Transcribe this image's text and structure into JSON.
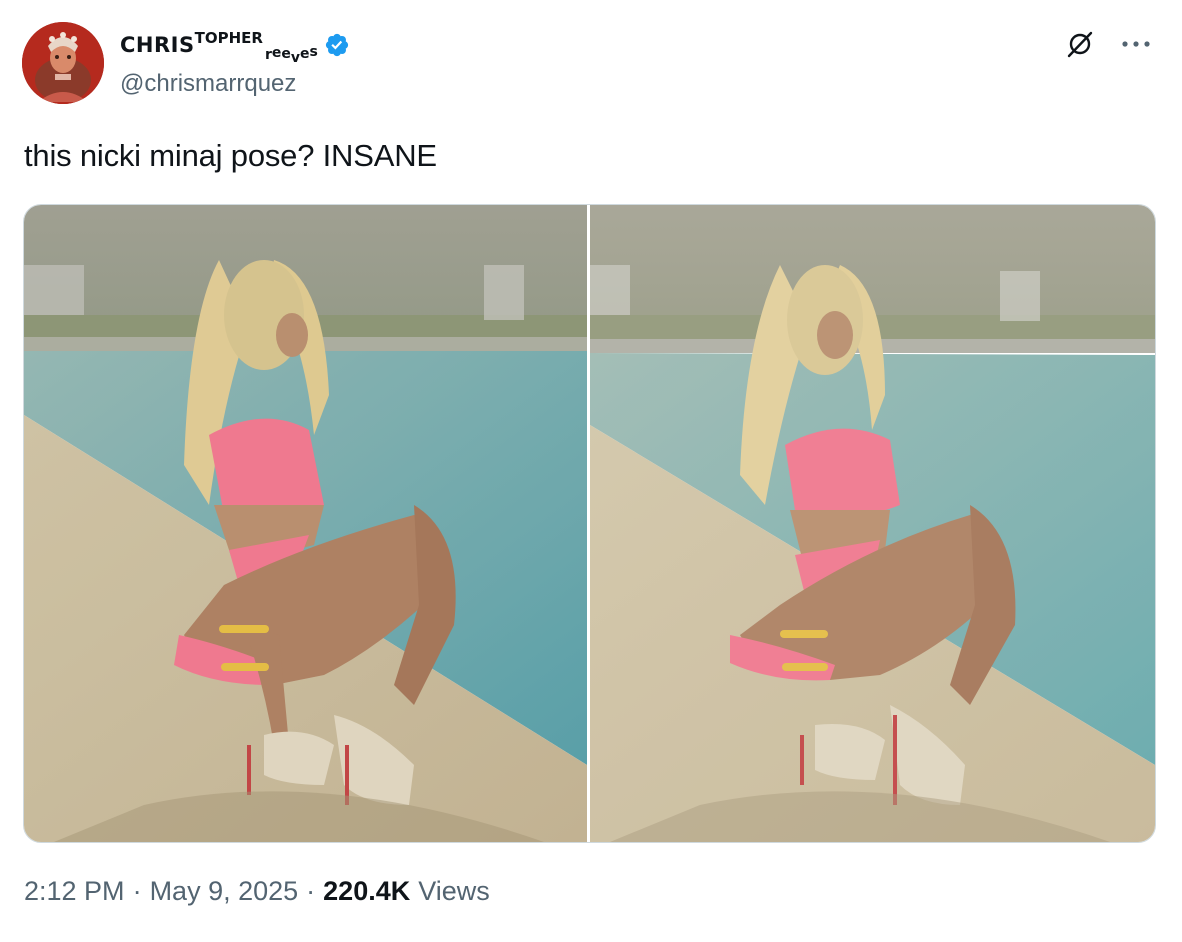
{
  "author": {
    "display_name_main": "CHRIS",
    "display_name_sup": "TOPHER",
    "display_name_sub": [
      "r",
      "e",
      "e",
      "v",
      "e",
      "s"
    ],
    "handle": "@chrismarrquez",
    "verified": true,
    "avatar_icon": "profile-avatar"
  },
  "actions": {
    "grok_icon": "grok-icon",
    "more_icon": "more-dots-icon"
  },
  "tweet": {
    "text": "this nicki minaj pose? INSANE"
  },
  "media": {
    "photos": [
      {
        "name": "photo-1",
        "icon": "pool-photo"
      },
      {
        "name": "photo-2",
        "icon": "pool-photo"
      }
    ]
  },
  "footer": {
    "time": "2:12 PM",
    "separator": "·",
    "date": "May 9, 2025",
    "views_count": "220.4K",
    "views_label": "Views"
  },
  "colors": {
    "text_primary": "#0f1419",
    "text_secondary": "#536471",
    "verified_blue": "#1d9bf0",
    "border": "#cfd9de",
    "pool_water": "#6fa9ad",
    "swimsuit_pink": "#ee6f86",
    "pool_deck": "#c9b896"
  }
}
